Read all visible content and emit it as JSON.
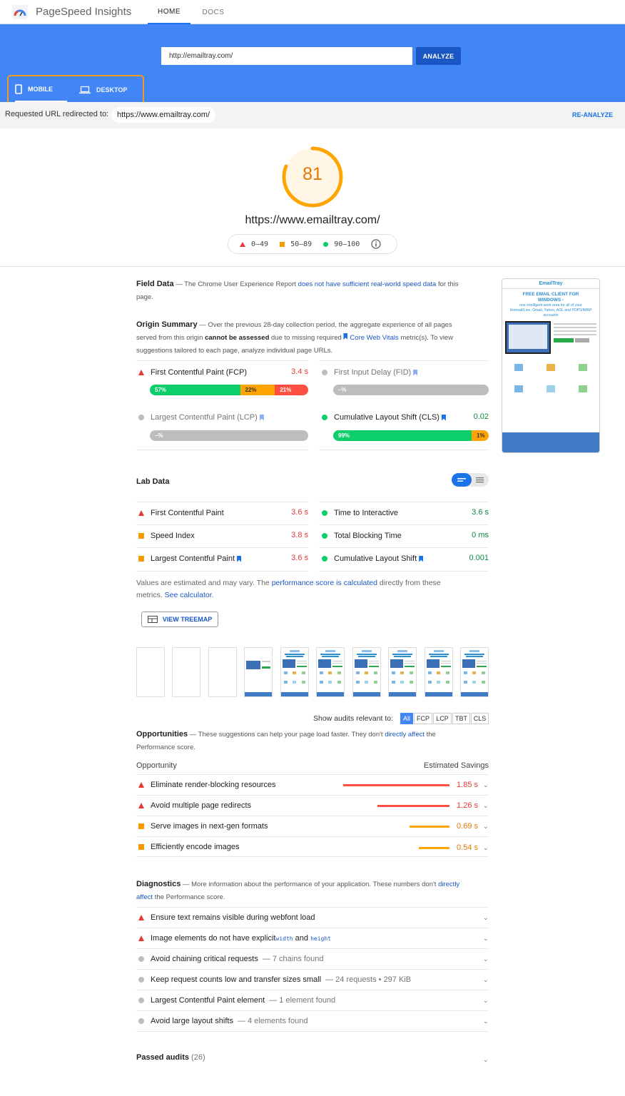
{
  "app": {
    "title": "PageSpeed Insights",
    "tabs": [
      "HOME",
      "DOCS"
    ]
  },
  "search": {
    "url": "http://emailtray.com/",
    "analyze_label": "ANALYZE"
  },
  "devices": {
    "mobile": "MOBILE",
    "desktop": "DESKTOP"
  },
  "redirect": {
    "label": "Requested URL redirected to:",
    "url": "https://www.emailtray.com/",
    "reanalyze": "RE-ANALYZE"
  },
  "score": {
    "value": "81",
    "fraction": 0.81,
    "url": "https://www.emailtray.com/",
    "legend": [
      "0–49",
      "50–89",
      "90–100"
    ],
    "color": "#ffa400"
  },
  "field_data": {
    "title": "Field Data",
    "desc_pre": "— The Chrome User Experience Report ",
    "desc_link": "does not have sufficient real-world speed data",
    "desc_post": " for this page."
  },
  "origin_summary": {
    "title": "Origin Summary",
    "line1": "— Over the previous 28-day collection period, the aggregate experience of all pages",
    "line2_pre": "served from this origin ",
    "line2_bold": "cannot be assessed",
    "line2_mid": " due to missing required ",
    "line2_link": "Core Web Vitals",
    "line2_post": " metric(s). To view",
    "line3": "suggestions tailored to each page, analyze individual page URLs.",
    "metrics": [
      {
        "name": "First Contentful Paint (FCP)",
        "value": "3.4 s",
        "bar": [
          "57%",
          "22%",
          "21%"
        ],
        "fractions": [
          0.57,
          0.22,
          0.21
        ]
      },
      {
        "name": "First Input Delay (FID)",
        "value": "",
        "bar": [
          "–%"
        ]
      },
      {
        "name": "Largest Contentful Paint (LCP)",
        "value": "",
        "bar": [
          "–%"
        ]
      },
      {
        "name": "Cumulative Layout Shift (CLS)",
        "value": "0.02",
        "bar": [
          "99%",
          "1%"
        ],
        "fractions": [
          0.89,
          0.11
        ]
      }
    ]
  },
  "lab_data": {
    "title": "Lab Data",
    "metrics": [
      {
        "name": "First Contentful Paint",
        "value": "3.6 s"
      },
      {
        "name": "Time to Interactive",
        "value": "3.6 s"
      },
      {
        "name": "Speed Index",
        "value": "3.8 s"
      },
      {
        "name": "Total Blocking Time",
        "value": "0 ms"
      },
      {
        "name": "Largest Contentful Paint",
        "value": "3.6 s"
      },
      {
        "name": "Cumulative Layout Shift",
        "value": "0.001"
      }
    ],
    "note_pre": "Values are estimated and may vary. The ",
    "note_link": "performance score is calculated",
    "note_post": " directly from these",
    "note_line2_pre": "metrics. ",
    "note_line2_link": "See calculator.",
    "treemap": "VIEW TREEMAP"
  },
  "filter": {
    "label": "Show audits relevant to:",
    "chips": [
      "All",
      "FCP",
      "LCP",
      "TBT",
      "CLS"
    ]
  },
  "opportunities": {
    "title": "Opportunities",
    "desc_pre": "— These suggestions can help your page load faster. They don't ",
    "desc_link": "directly affect",
    "desc_post": " the",
    "desc_line2": "Performance score.",
    "col_left": "Opportunity",
    "col_right": "Estimated Savings",
    "items": [
      {
        "name": "Eliminate render-blocking resources",
        "value": "1.85 s",
        "savings_s": 1.85
      },
      {
        "name": "Avoid multiple page redirects",
        "value": "1.26 s",
        "savings_s": 1.26
      },
      {
        "name": "Serve images in next-gen formats",
        "value": "0.69 s",
        "savings_s": 0.69
      },
      {
        "name": "Efficiently encode images",
        "value": "0.54 s",
        "savings_s": 0.54
      }
    ]
  },
  "diagnostics": {
    "title": "Diagnostics",
    "desc_pre": "— More information about the performance of your application. These numbers don't ",
    "desc_link1": "directly",
    "desc_link2": "affect",
    "desc_post": " the Performance score.",
    "items": [
      {
        "name": "Ensure text remains visible during webfont load",
        "sub": ""
      },
      {
        "name_pre": "Image elements do not have explicit ",
        "code1": "width",
        "and": " and ",
        "code2": "height"
      },
      {
        "name": "Avoid chaining critical requests",
        "sub": "— 7 chains found"
      },
      {
        "name": "Keep request counts low and transfer sizes small",
        "sub": "— 24 requests • 297 KiB"
      },
      {
        "name": "Largest Contentful Paint element",
        "sub": "— 1 element found"
      },
      {
        "name": "Avoid large layout shifts",
        "sub": "— 4 elements found"
      }
    ]
  },
  "passed": {
    "title": "Passed audits",
    "count": "(26)"
  },
  "thumbnail": {
    "brand": "EmailTray",
    "headline1": "FREE EMAIL CLIENT FOR",
    "headline2": "WINDOWS -",
    "sub": "one intelligent work area for all of your Hotmail/Live, Gmail, Yahoo, AOL and POP3/IMAP accounts"
  },
  "colors": {
    "blue": "#4285f4",
    "red": "#ff4e42",
    "orange": "#ffa400",
    "green": "#0cce6b"
  }
}
